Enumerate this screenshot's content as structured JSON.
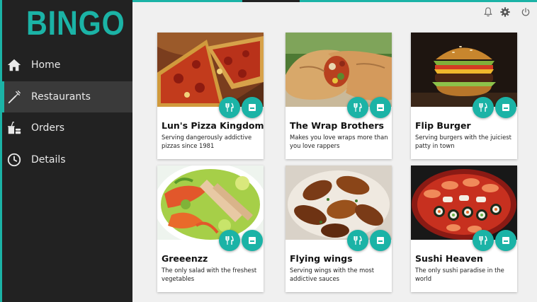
{
  "app": {
    "logo": "BINGO"
  },
  "sidebar": {
    "items": [
      {
        "label": "Home",
        "icon": "home-icon"
      },
      {
        "label": "Restaurants",
        "icon": "fork-knife-icon",
        "active": true
      },
      {
        "label": "Orders",
        "icon": "takeout-icon"
      },
      {
        "label": "Details",
        "icon": "clock-icon"
      }
    ]
  },
  "topbar": {
    "icons": [
      "bell-icon",
      "gear-icon",
      "power-icon"
    ]
  },
  "restaurants": [
    {
      "name": "Lun's Pizza Kingdom",
      "description": "Serving dangerously addictive pizzas since 1981"
    },
    {
      "name": "The Wrap Brothers",
      "description": "Makes you love wraps more than you love rappers"
    },
    {
      "name": "Flip Burger",
      "description": "Serving burgers with the juiciest patty in town"
    },
    {
      "name": "Greeenzz",
      "description": "The only salad with the freshest vegetables"
    },
    {
      "name": "Flying wings",
      "description": "Serving wings with the most addictive sauces"
    },
    {
      "name": "Sushi Heaven",
      "description": "The only sushi paradise in the world"
    }
  ],
  "colors": {
    "accent": "#1bb3a6",
    "sidebar": "#222222",
    "background": "#f0f0f0"
  }
}
